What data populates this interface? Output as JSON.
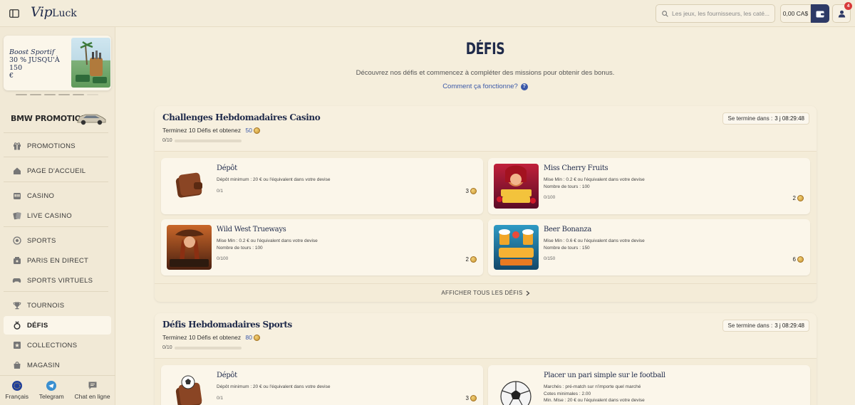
{
  "header": {
    "logo_main": "Vip",
    "logo_rest": "Luck",
    "search_placeholder": "Les jeux, les fournisseurs, les caté...",
    "balance": "0,00 CA$",
    "notification_count": "4"
  },
  "sidebar": {
    "promo": {
      "line1": "Boost Sportif",
      "line2": "30 % JUSQU'À 150",
      "line3": "€"
    },
    "bmw_label": "BMW PROMOTION",
    "items": [
      {
        "label": "PROMOTIONS",
        "icon": "gift-icon"
      },
      {
        "label": "PAGE D'ACCUEIL",
        "icon": "home-icon"
      },
      {
        "label": "CASINO",
        "icon": "slot-machine-icon"
      },
      {
        "label": "LIVE CASINO",
        "icon": "cards-icon"
      },
      {
        "label": "SPORTS",
        "icon": "soccer-ball-icon"
      },
      {
        "label": "PARIS EN DIRECT",
        "icon": "live-betting-icon"
      },
      {
        "label": "SPORTS VIRTUELS",
        "icon": "gamepad-icon"
      },
      {
        "label": "TOURNOIS",
        "icon": "trophy-icon"
      },
      {
        "label": "DÉFIS",
        "icon": "medal-icon"
      },
      {
        "label": "COLLECTIONS",
        "icon": "collection-icon"
      },
      {
        "label": "MAGASIN",
        "icon": "shop-icon"
      }
    ],
    "footer": {
      "language": "Français",
      "telegram": "Telegram",
      "chat": "Chat en ligne"
    }
  },
  "main": {
    "title": "DÉFIS",
    "subtitle": "Découvrez nos défis et commencez à compléter des missions pour obtenir des bonus.",
    "how_link": "Comment ça fonctionne?",
    "show_all": "AFFICHER TOUS LES DÉFIS",
    "sections": [
      {
        "title": "Challenges Hebdomadaires Casino",
        "goal_prefix": "Terminez 10 Défis et obtenez",
        "goal_amount": "50",
        "progress": "0/10",
        "progress_fraction": 0.0,
        "ends_label": "Se termine dans :",
        "ends_value": "3 j 08:29:48",
        "cards": [
          {
            "title": "Dépôt",
            "desc1": "Dépôt minimum : 20 € ou l'équivalent dans votre devise",
            "desc2": "",
            "desc3": "",
            "progress": "0/1",
            "reward": "3"
          },
          {
            "title": "Miss Cherry Fruits",
            "desc1": "Mise Min : 0.2 € ou l'équivalent dans votre devise",
            "desc2": "Nombre de tours : 100",
            "desc3": "",
            "progress": "0/100",
            "reward": "2"
          },
          {
            "title": "Wild West Trueways",
            "desc1": "Mise Min : 0.2 € ou l'équivalent dans votre devise",
            "desc2": "Nombre de tours : 100",
            "desc3": "",
            "progress": "0/100",
            "reward": "2"
          },
          {
            "title": "Beer Bonanza",
            "desc1": "Mise Min : 0.6 € ou l'équivalent dans votre devise",
            "desc2": "Nombre de tours : 150",
            "desc3": "",
            "progress": "0/150",
            "reward": "6"
          }
        ]
      },
      {
        "title": "Défis Hebdomadaires Sports",
        "goal_prefix": "Terminez 10 Défis et obtenez",
        "goal_amount": "80",
        "progress": "0/10",
        "progress_fraction": 0.0,
        "ends_label": "Se termine dans :",
        "ends_value": "3 j 08:29:48",
        "cards": [
          {
            "title": "Dépôt",
            "desc1": "Dépôt minimum : 20 € ou l'équivalent dans votre devise",
            "desc2": "",
            "desc3": "",
            "progress": "0/1",
            "reward": "3"
          },
          {
            "title": "Placer un pari simple sur le football",
            "desc1": "Marchés : pré-match sur n'importe quel marché",
            "desc2": "Cotes minimales : 2.00",
            "desc3": "Min. Mise : 20 € ou l'équivalent dans votre devise",
            "progress": "",
            "reward": ""
          }
        ]
      }
    ]
  },
  "colors": {
    "accent": "#3a58a8",
    "navy": "#1f2a4a",
    "background": "#f5eedc"
  }
}
